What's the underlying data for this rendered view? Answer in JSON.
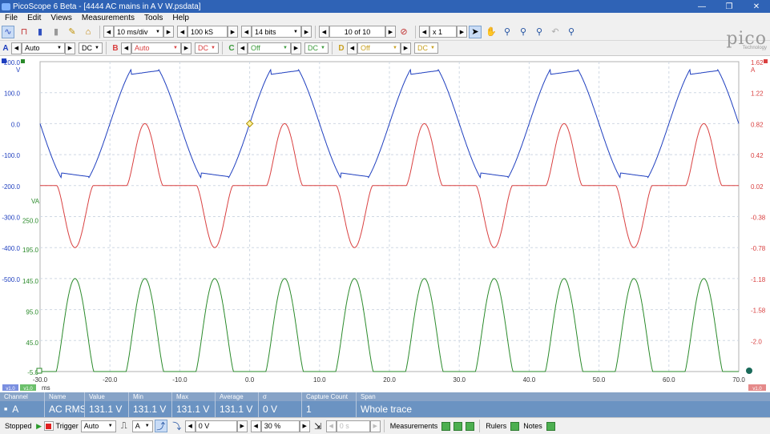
{
  "window": {
    "title": "PicoScope 6 Beta - [4444 AC mains  in A V W.psdata]",
    "minimize": "—",
    "maximize": "❐",
    "close": "✕"
  },
  "menu": [
    "File",
    "Edit",
    "Views",
    "Measurements",
    "Tools",
    "Help"
  ],
  "toolbar": {
    "timebase": "10 ms/div",
    "samples": "100 kS",
    "resolution": "14 bits",
    "buffer": "10 of 10",
    "zoom": "x 1"
  },
  "channels": [
    {
      "id": "A",
      "range": "Auto",
      "coupling": "DC",
      "color": "#1f3fbf"
    },
    {
      "id": "B",
      "range": "Auto",
      "coupling": "DC",
      "color": "#d94040"
    },
    {
      "id": "C",
      "range": "Off",
      "coupling": "DC",
      "color": "#3a9a3a"
    },
    {
      "id": "D",
      "range": "Off",
      "coupling": "DC",
      "color": "#c8a020"
    }
  ],
  "logo": {
    "main": "pico",
    "sub": "Technology"
  },
  "plot": {
    "left_axis": {
      "unit": "V",
      "ticks": [
        "200.0",
        "100.0",
        "0.0",
        "-100.0",
        "-200.0",
        "-300.0",
        "-400.0",
        "-500.0"
      ],
      "color": "#1f3fbf"
    },
    "va_axis": {
      "unit": "VA",
      "ticks": [
        "250.0",
        "195.0",
        "145.0",
        "95.0",
        "45.0",
        "-5.0"
      ],
      "color": "#2a8a2a"
    },
    "right_axis": {
      "unit": "A",
      "ticks": [
        "1.62",
        "1.22",
        "0.82",
        "0.42",
        "0.02",
        "-0.38",
        "-0.78",
        "-1.18",
        "-1.58",
        "-2.0"
      ],
      "color": "#d94040"
    },
    "x_axis": {
      "unit": "ms",
      "ticks": [
        "-30.0",
        "-20.0",
        "-10.0",
        "0.0",
        "10.0",
        "20.0",
        "30.0",
        "40.0",
        "50.0",
        "60.0",
        "70.0"
      ]
    },
    "ruler_tags": {
      "left1": "v1.0",
      "left2": "v1.0",
      "right": "v1.0"
    }
  },
  "chart_data": {
    "type": "line",
    "xlabel": "ms",
    "xlim": [
      -30,
      70
    ],
    "series": [
      {
        "name": "A",
        "unit": "V",
        "color": "#1f3fbf",
        "period_ms": 20,
        "shape": "clipped-sine",
        "peak": 175,
        "trough": -175
      },
      {
        "name": "B",
        "unit": "A",
        "color": "#d94040",
        "period_ms": 20,
        "shape": "pulsed",
        "peak": 0.82,
        "trough": -0.78,
        "baseline": 0.02
      },
      {
        "name": "VA",
        "unit": "VA",
        "color": "#2a8a2a",
        "period_ms": 10,
        "shape": "pulsed",
        "peak": 145,
        "baseline": -5
      }
    ]
  },
  "measurements": {
    "headers": [
      "Channel",
      "Name",
      "Value",
      "Min",
      "Max",
      "Average",
      "σ",
      "Capture Count",
      "Span"
    ],
    "rows": [
      [
        "A",
        "AC RMS",
        "131.1 V",
        "131.1 V",
        "131.1 V",
        "131.1 V",
        "0 V",
        "1",
        "Whole trace"
      ]
    ]
  },
  "status": {
    "state": "Stopped",
    "trigger_label": "Trigger",
    "trigger_mode": "Auto",
    "trigger_channel": "A",
    "threshold": "0 V",
    "pretrigger": "30 %",
    "delay": "0 s",
    "measurements_label": "Measurements",
    "rulers_label": "Rulers",
    "notes_label": "Notes"
  }
}
